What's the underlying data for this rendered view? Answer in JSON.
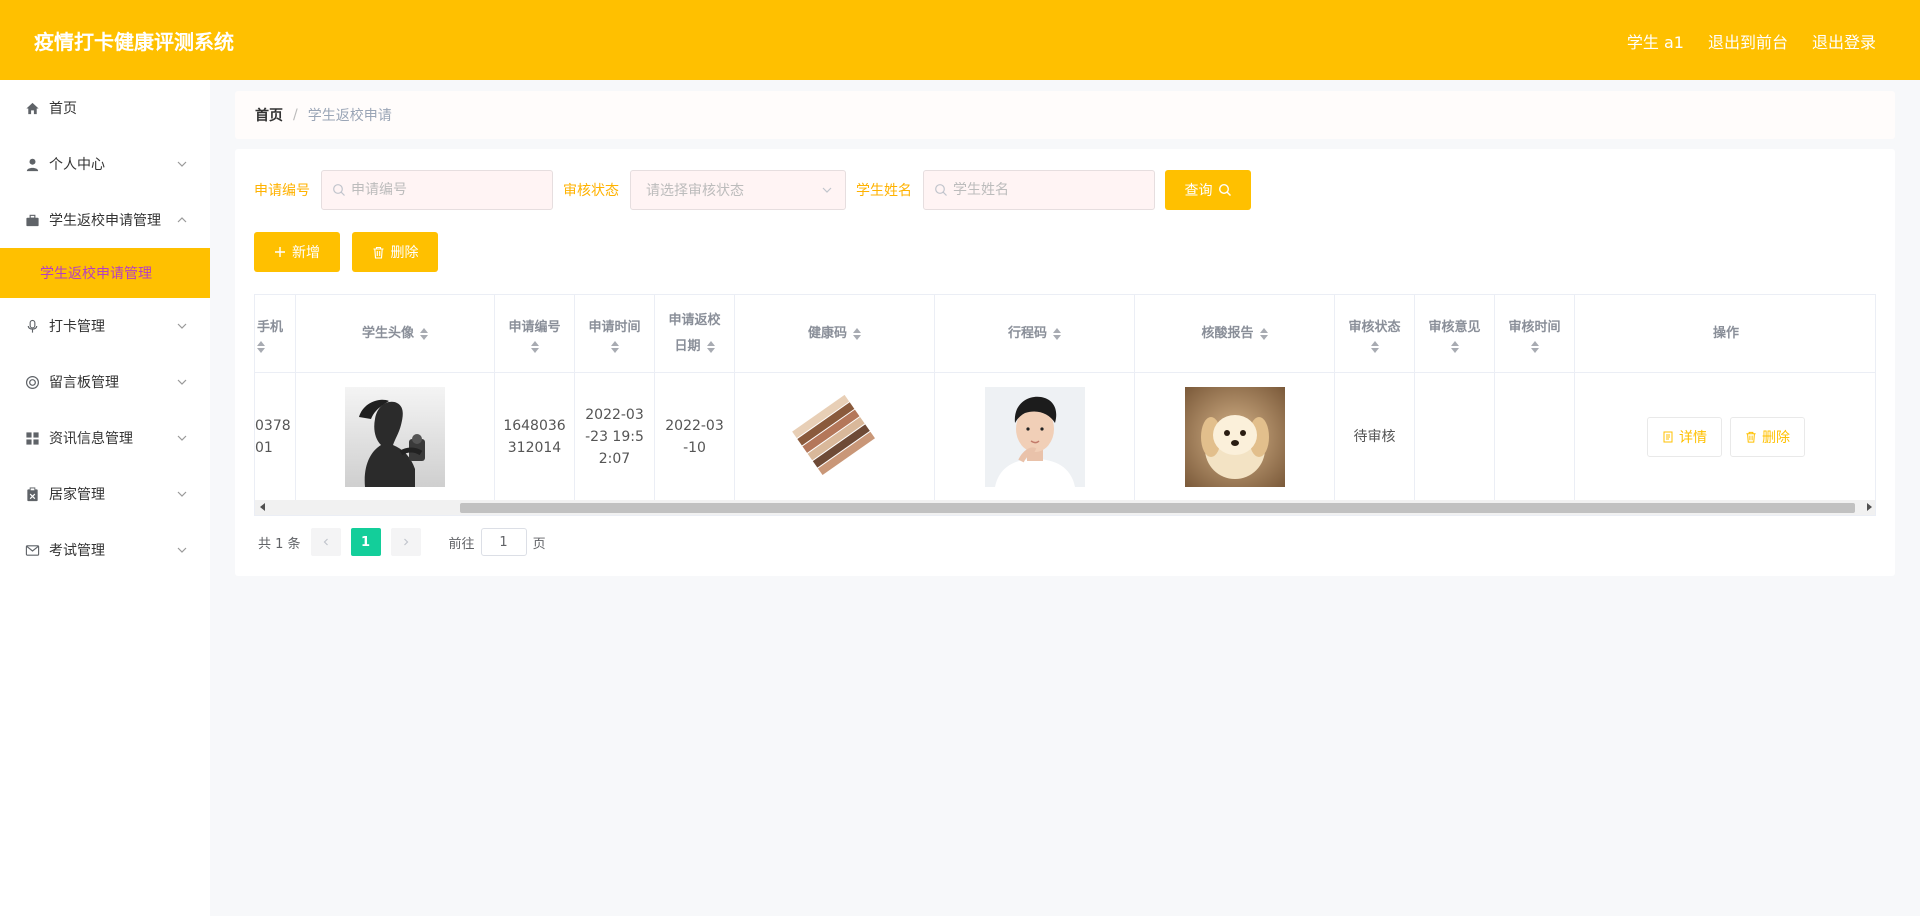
{
  "header": {
    "title": "疫情打卡健康评测系统",
    "user": "学生 a1",
    "to_front": "退出到前台",
    "logout": "退出登录"
  },
  "sidebar": {
    "items": [
      {
        "label": "首页",
        "icon": "home-icon"
      },
      {
        "label": "个人中心",
        "icon": "user-icon"
      },
      {
        "label": "学生返校申请管理",
        "icon": "briefcase-icon",
        "expanded": true
      },
      {
        "label": "打卡管理",
        "icon": "microphone-icon"
      },
      {
        "label": "留言板管理",
        "icon": "lifebuoy-icon"
      },
      {
        "label": "资讯信息管理",
        "icon": "grid-icon"
      },
      {
        "label": "居家管理",
        "icon": "clipboard-icon"
      },
      {
        "label": "考试管理",
        "icon": "mail-icon"
      }
    ],
    "subitem": "学生返校申请管理"
  },
  "breadcrumb": {
    "home": "首页",
    "separator": "/",
    "current": "学生返校申请"
  },
  "search": {
    "apply_no_label": "申请编号",
    "apply_no_placeholder": "申请编号",
    "status_label": "审核状态",
    "status_placeholder": "请选择审核状态",
    "name_label": "学生姓名",
    "name_placeholder": "学生姓名",
    "query_button": "查询"
  },
  "actions": {
    "add": "新增",
    "delete": "删除"
  },
  "table": {
    "columns": {
      "phone": "手机",
      "avatar": "学生头像",
      "apply_no": "申请编号",
      "apply_time": "申请时间",
      "return_date_1": "申请返校",
      "return_date_2": "日期",
      "health_code": "健康码",
      "trip_code": "行程码",
      "nucleic": "核酸报告",
      "status": "审核状态",
      "opinion": "审核意见",
      "review_time": "审核时间",
      "ops": "操作"
    },
    "rows": [
      {
        "phone_1": "0378",
        "phone_2": "01",
        "apply_no_1": "1648036",
        "apply_no_2": "312014",
        "apply_time_1": "2022-03",
        "apply_time_2": "-23 19:5",
        "apply_time_3": "2:07",
        "return_date_1": "2022-03",
        "return_date_2": "-10",
        "status": "待审核",
        "opinion": "",
        "review_time": "",
        "detail_button": "详情",
        "delete_button": "删除"
      }
    ]
  },
  "pagination": {
    "total": "共 1 条",
    "current_page": "1",
    "goto_prefix": "前往",
    "goto_value": "1",
    "goto_suffix": "页"
  },
  "colors": {
    "primary": "#ffc000",
    "submenu_text": "#b43fc4",
    "page_active": "#13ce9a"
  }
}
